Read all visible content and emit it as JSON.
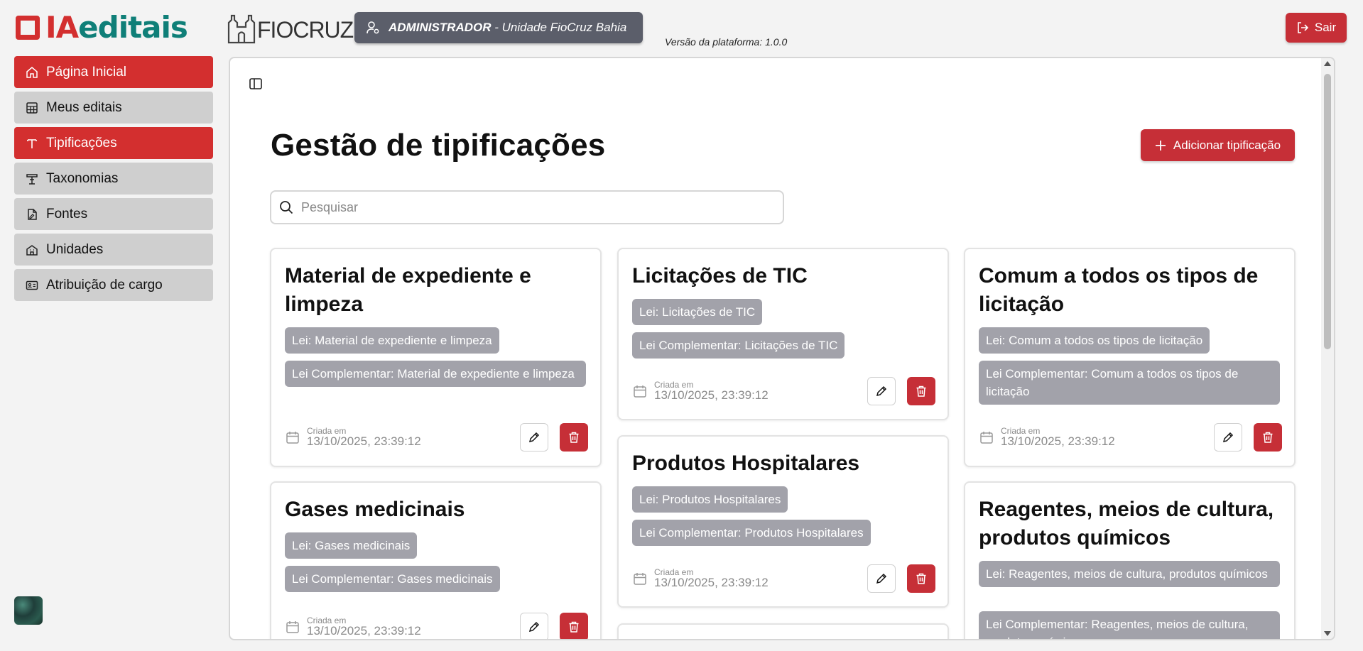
{
  "header": {
    "logo_ia": "IA",
    "logo_editais": "editais",
    "logo_fiocruz": "FIOCRUZ",
    "user_role": "ADMINISTRADOR",
    "user_unit": " - Unidade FioCruz Bahia",
    "version": "Versão da plataforma: 1.0.0",
    "logout_label": "Sair"
  },
  "sidebar": {
    "items": [
      {
        "label": "Página Inicial",
        "icon": "home-icon"
      },
      {
        "label": "Meus editais",
        "icon": "table-icon"
      },
      {
        "label": "Tipificações",
        "icon": "type-icon"
      },
      {
        "label": "Taxonomias",
        "icon": "taxonomy-icon"
      },
      {
        "label": "Fontes",
        "icon": "file-source-icon"
      },
      {
        "label": "Unidades",
        "icon": "building-icon"
      },
      {
        "label": "Atribuição de cargo",
        "icon": "id-card-icon"
      }
    ]
  },
  "main": {
    "title": "Gestão de tipificações",
    "add_label": "Adicionar tipificação",
    "search_placeholder": "Pesquisar",
    "created_label": "Criada em",
    "cards": [
      {
        "title": "Material de expediente e limpeza",
        "lei": "Lei: Material de expediente e limpeza",
        "lei_complementar": "Lei Complementar: Material de expediente e limpeza",
        "date": "13/10/2025, 23:39:12"
      },
      {
        "title": "Licitações de TIC",
        "lei": "Lei: Licitações de TIC",
        "lei_complementar": "Lei Complementar: Licitações de TIC",
        "date": "13/10/2025, 23:39:12"
      },
      {
        "title": "Comum a todos os tipos de licitação",
        "lei": "Lei: Comum a todos os tipos de licitação",
        "lei_complementar": "Lei Complementar: Comum a todos os tipos de licitação",
        "date": "13/10/2025, 23:39:12"
      },
      {
        "title": "Gases medicinais",
        "lei": "Lei: Gases medicinais",
        "lei_complementar": "Lei Complementar: Gases medicinais",
        "date": "13/10/2025, 23:39:12"
      },
      {
        "title": "Produtos Hospitalares",
        "lei": "Lei: Produtos Hospitalares",
        "lei_complementar": "Lei Complementar: Produtos Hospitalares",
        "date": "13/10/2025, 23:39:12"
      },
      {
        "title": "Reagentes, meios de cultura, produtos químicos",
        "lei": "Lei: Reagentes, meios de cultura, produtos químicos",
        "lei_complementar": "Lei Complementar: Reagentes, meios de cultura, produtos químicos"
      }
    ]
  },
  "colors": {
    "brand_red": "#d32f2f",
    "button_red": "#c62f37",
    "chip_gray": "#a2a2aa",
    "user_chip": "#5b5e6a",
    "nav_gray": "#cfcfcf"
  }
}
